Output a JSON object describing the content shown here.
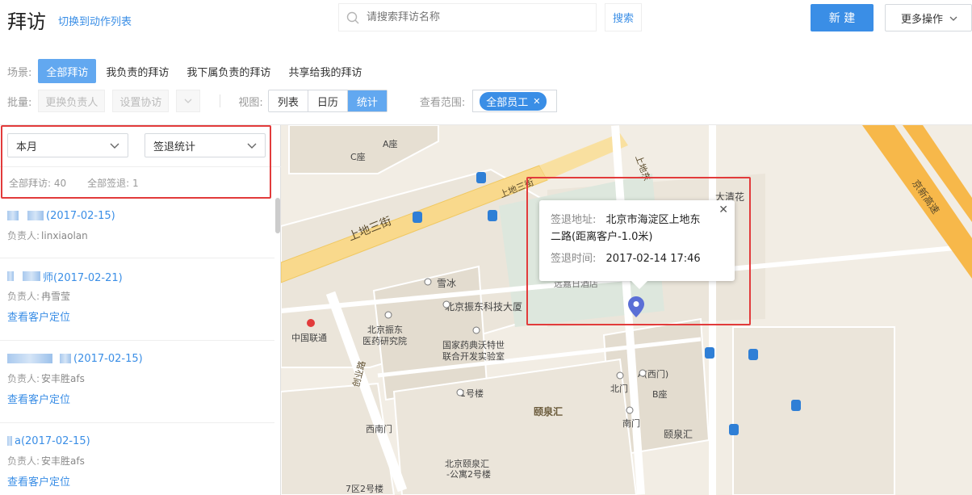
{
  "header": {
    "title": "拜访",
    "switch_link": "切换到动作列表",
    "search_placeholder": "请搜索拜访名称",
    "search_button": "搜索",
    "new_button": "新 建",
    "more_button": "更多操作"
  },
  "filters": {
    "scene_label": "场景:",
    "scenes": [
      "全部拜访",
      "我负责的拜访",
      "我下属负责的拜访",
      "共享给我的拜访"
    ],
    "batch_label": "批量:",
    "batch_buttons": [
      "更换负责人",
      "设置协访"
    ],
    "view_label": "视图:",
    "views": [
      "列表",
      "日历",
      "统计"
    ],
    "range_label": "查看范围:",
    "range_tag": "全部员工"
  },
  "left_panel": {
    "period_select": "本月",
    "stat_type_select": "签退统计",
    "total_visits": "全部拜访: 40",
    "total_checkout": "全部签退: 1",
    "items": [
      {
        "title": "(2017-02-15)",
        "owner_label": "负责人:",
        "owner": "linxiaolan",
        "locate": ""
      },
      {
        "title": "师(2017-02-21)",
        "owner_label": "负责人:",
        "owner": "冉雪莹",
        "locate": "查看客户定位"
      },
      {
        "title": "(2017-02-15)",
        "owner_label": "负责人:",
        "owner": "安丰胜afs",
        "locate": "查看客户定位"
      },
      {
        "title": "a(2017-02-15)",
        "owner_label": "负责人:",
        "owner": "安丰胜afs",
        "locate": "查看客户定位"
      }
    ]
  },
  "map": {
    "popup": {
      "addr_label": "签退地址:",
      "addr_line1": "北京市海淀区上地东",
      "addr_line2": "二路(距离客户-1.0米)",
      "time_label": "签退时间:",
      "time_value": "2017-02-14 17:46"
    },
    "labels": {
      "c_zuo": "C座",
      "a_zuo": "A座",
      "shangdi3": "上地三街",
      "shangdi_e": "上地东",
      "daqinghua": "大清花",
      "jingxin": "京新高速",
      "xuebing": "雪冰",
      "zhendong": "北京振东科技大厦",
      "zhendong_yy1": "北京振东",
      "zhendong_yy2": "医药研究院",
      "liantong": "中国联通",
      "guojia1": "国家药典沃特世",
      "guojia2": "联合开发实验室",
      "a_ximen": "A(西门)",
      "beimen": "北门",
      "b_zuo": "B座",
      "no1": "1号楼",
      "yiquanhui": "颐泉汇",
      "nanmen": "南门",
      "ximennan": "西南门",
      "yiquanhui2": "颐泉汇",
      "gongyu1": "北京颐泉汇",
      "gongyu2": "-公寓2号楼",
      "qu7": "7区2号楼",
      "chuangye": "创业路",
      "jiudian": "远嘉日酒店"
    }
  },
  "colors": {
    "accent": "#3a8ee6",
    "active_bg": "#62a8f0",
    "highlight_box": "#e23b3b",
    "pin": "#5b6fd6"
  }
}
